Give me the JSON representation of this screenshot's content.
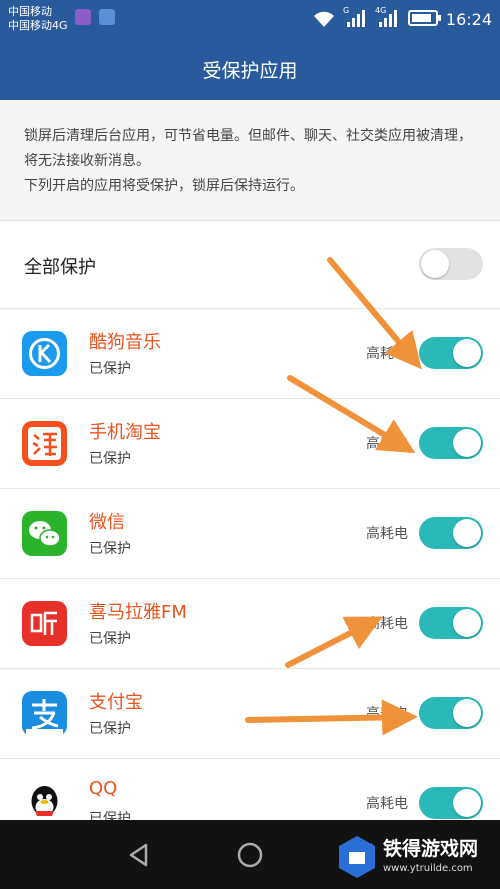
{
  "status_bar": {
    "carrier_line1": "中国移动",
    "carrier_line2": "中国移动4G",
    "signal_label_1": "G",
    "signal_label_2": "4G",
    "time": "16:24"
  },
  "header": {
    "title": "受保护应用"
  },
  "description": {
    "line1": "锁屏后清理后台应用，可节省电量。但邮件、聊天、社交类应用被清理，将无法接收新消息。",
    "line2": "下列开启的应用将受保护，锁屏后保持运行。"
  },
  "protect_all": {
    "label": "全部保护",
    "enabled": false
  },
  "apps": [
    {
      "name": "酷狗音乐",
      "status": "已保护",
      "power": "高耗电",
      "enabled": true,
      "icon": "kugou-app-icon"
    },
    {
      "name": "手机淘宝",
      "status": "已保护",
      "power": "高耗电",
      "enabled": true,
      "icon": "taobao-app-icon"
    },
    {
      "name": "微信",
      "status": "已保护",
      "power": "高耗电",
      "enabled": true,
      "icon": "wechat-app-icon"
    },
    {
      "name": "喜马拉雅FM",
      "status": "已保护",
      "power": "高耗电",
      "enabled": true,
      "icon": "ximalaya-app-icon"
    },
    {
      "name": "支付宝",
      "status": "已保护",
      "power": "高耗电",
      "enabled": true,
      "icon": "alipay-app-icon"
    },
    {
      "name": "QQ",
      "status": "已保护",
      "power": "高耗电",
      "enabled": true,
      "icon": "qq-app-icon"
    }
  ],
  "watermark": {
    "brand": "铁得游戏网",
    "url": "www.ytruilde.com"
  },
  "colors": {
    "header": "#285a9c",
    "accent": "#2bb8b8",
    "app_name": "#e8541e",
    "arrow": "#f0923a"
  }
}
